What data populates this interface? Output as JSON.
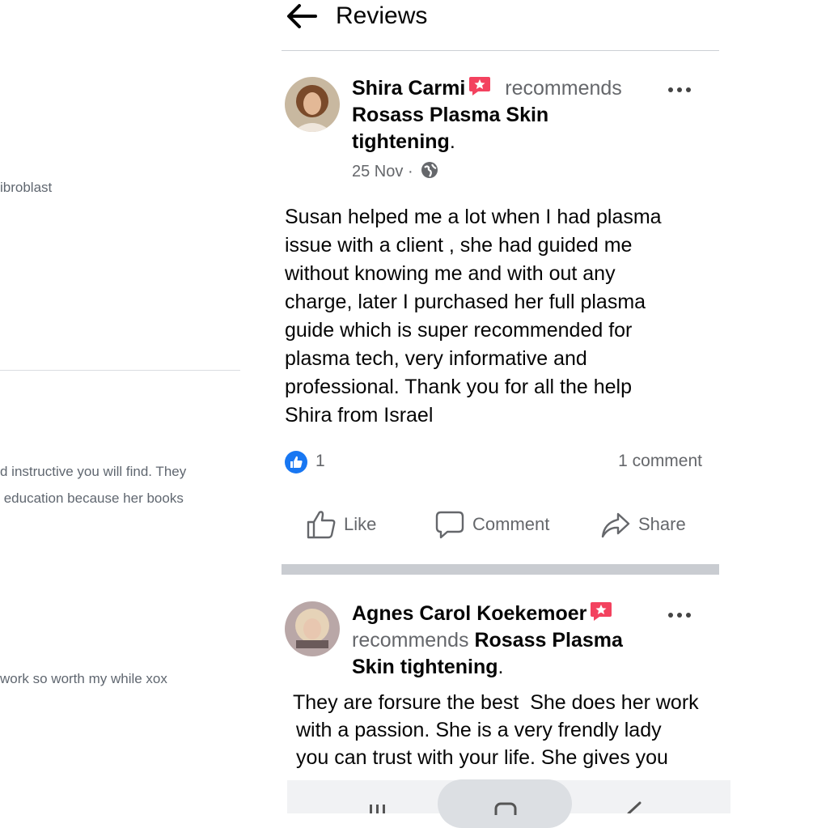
{
  "background": {
    "fragments": [
      "ibroblast",
      "d instructive you will find. They",
      " education because her books",
      "work so worth my while xox"
    ]
  },
  "header": {
    "title": "Reviews"
  },
  "reviews": [
    {
      "author": "Shira Carmi",
      "verb": "recommends",
      "target": "Rosass Plasma Skin tightening",
      "target_line1": "Rosass Plasma Skin",
      "target_line2": "tightening",
      "period": ".",
      "date": "25 Nov",
      "date_sep": "·",
      "privacy_icon": "globe-icon",
      "text_lines": [
        "Susan helped me a lot when I had plasma",
        "issue with a client , she had guided me",
        "without knowing me and with out any",
        "charge, later I purchased her full plasma",
        "guide which is super recommended for",
        "plasma tech, very informative and",
        "professional. Thank you for all the help",
        "Shira from Israel"
      ],
      "reaction_count": "1",
      "comment_count": "1 comment"
    },
    {
      "author": "Agnes Carol Koekemoer",
      "verb": "recommends",
      "target_part1": "Rosass Plasma",
      "target_part2": "Skin tightening",
      "period": ".",
      "text_lines": [
        "They are forsure the best  She does her work",
        "with a passion. She is a very frendly lady",
        "you can trust with your life. She gives you"
      ]
    }
  ],
  "actions": {
    "like": "Like",
    "comment": "Comment",
    "share": "Share"
  },
  "colors": {
    "like_blue": "#1877f2",
    "badge_pink": "#f3425f",
    "muted": "#65676b"
  }
}
